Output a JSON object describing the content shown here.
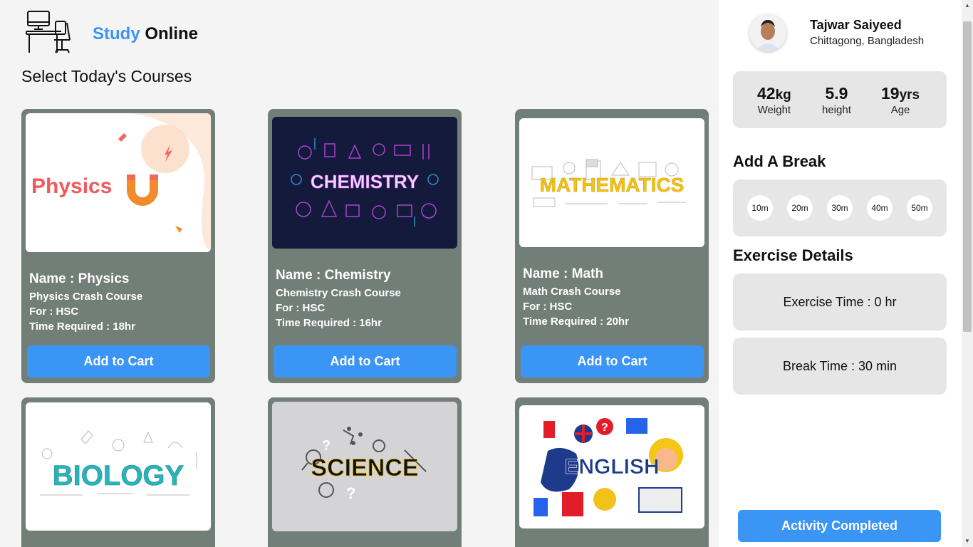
{
  "brand": {
    "accent": "Study",
    "rest": "Online"
  },
  "section_title": "Select Today's Courses",
  "courses": [
    {
      "image_text": "Physics",
      "name": "Name : Physics",
      "course": "Physics Crash Course",
      "for": "For : HSC",
      "time": "Time Required : 18hr",
      "button": "Add to Cart"
    },
    {
      "image_text": "CHEMISTRY",
      "name": "Name : Chemistry",
      "course": "Chemistry Crash Course",
      "for": "For : HSC",
      "time": "Time Required : 16hr",
      "button": "Add to Cart"
    },
    {
      "image_text": "MATHEMATICS",
      "name": "Name : Math",
      "course": "Math Crash Course",
      "for": "For : HSC",
      "time": "Time Required : 20hr",
      "button": "Add to Cart"
    },
    {
      "image_text": "BIOLOGY"
    },
    {
      "image_text": "SCIENCE"
    },
    {
      "image_text": "ENGLISH"
    }
  ],
  "user": {
    "name": "Tajwar Saiyeed",
    "location": "Chittagong, Bangladesh"
  },
  "stats": [
    {
      "value": "42",
      "unit": "kg",
      "label": "Weight"
    },
    {
      "value": "5.9",
      "unit": "",
      "label": "height"
    },
    {
      "value": "19",
      "unit": "yrs",
      "label": "Age"
    }
  ],
  "break_title": "Add A Break",
  "breaks": [
    "10m",
    "20m",
    "30m",
    "40m",
    "50m"
  ],
  "exercise_title": "Exercise Details",
  "exercise_time": "Exercise Time : 0 hr",
  "break_time": "Break Time : 30 min",
  "complete_button": "Activity Completed",
  "colors": {
    "accent": "#3b95f5",
    "card": "#727f79",
    "panel": "#e6e6e6"
  }
}
